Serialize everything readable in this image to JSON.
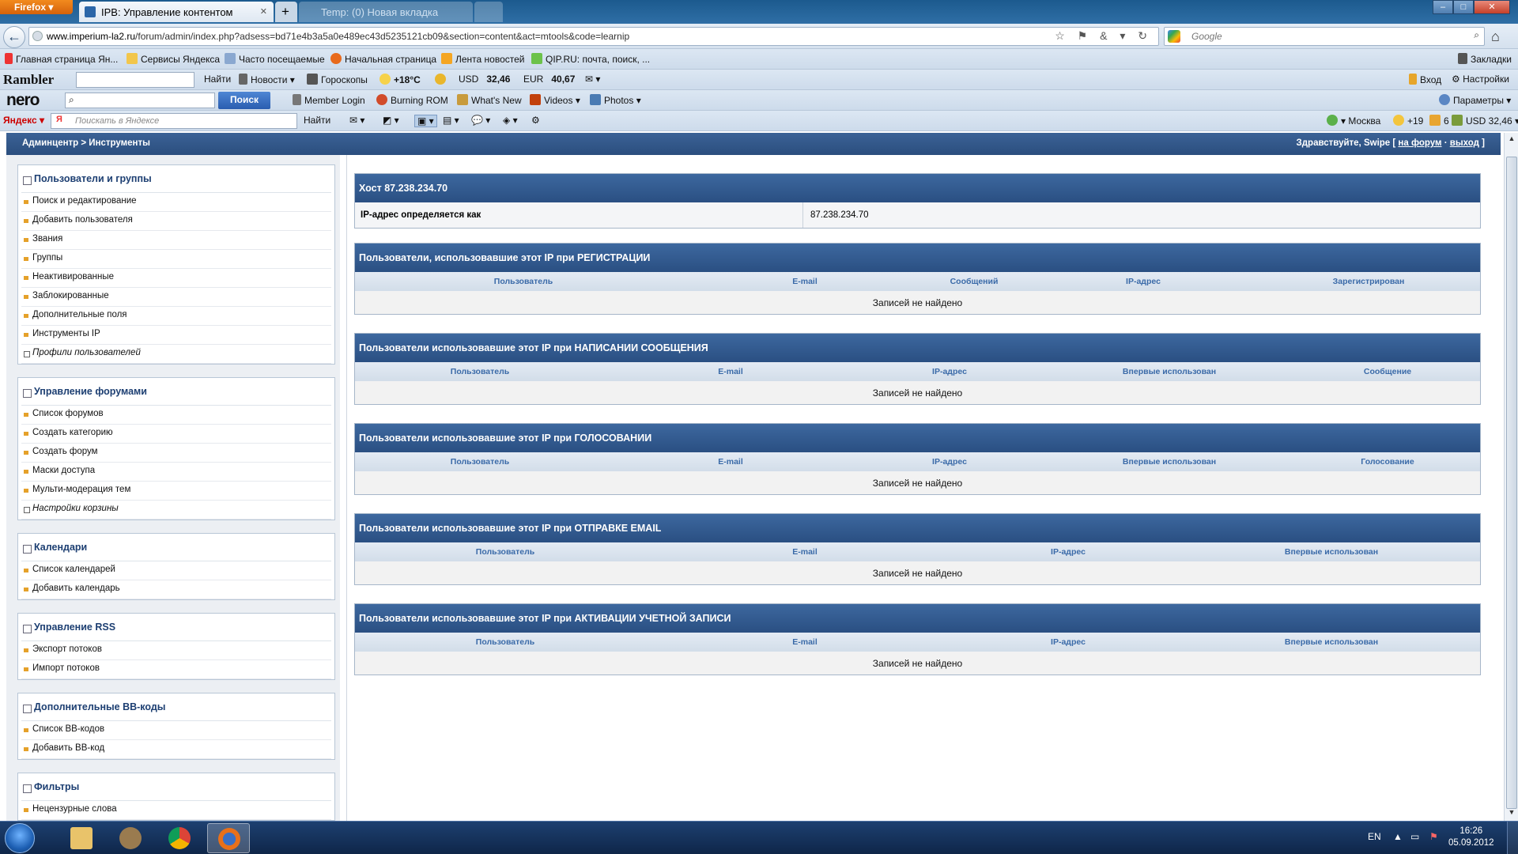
{
  "browser": {
    "firefox_label": "Firefox",
    "tabs": [
      {
        "title": "IPB: Управление контентом"
      },
      {
        "title": "Temp: (0) Новая вкладка"
      }
    ],
    "new_tab": "+",
    "url_host": "www.imperium-la2.ru",
    "url_path": "/forum/admin/index.php?adsess=bd71e4b3a5a0e489ec43d5235121cb09&section=content&act=mtools&code=learnip",
    "search_placeholder": "Google",
    "controls": {
      "minimize": "–",
      "maximize": "□",
      "close": "✕"
    }
  },
  "bookmarks": {
    "items": [
      "Главная страница Ян...",
      "Сервисы Яндекса",
      "Часто посещаемые",
      "Начальная страница",
      "Лента новостей",
      "QIP.RU: почта, поиск, ..."
    ],
    "right": "Закладки"
  },
  "rambler_bar": {
    "logo": "Rambler",
    "find": "Найти",
    "news": "Новости",
    "horoscopes": "Гороскопы",
    "temp": "+18°C",
    "usd_label": "USD",
    "usd": "32,46",
    "eur_label": "EUR",
    "eur": "40,67",
    "login": "Вход",
    "settings": "Настройки"
  },
  "nero_bar": {
    "logo": "nero",
    "search_btn": "Поиск",
    "items": [
      "Member Login",
      "Burning ROM",
      "What's New",
      "Videos",
      "Photos"
    ],
    "params": "Параметры"
  },
  "yandex_bar": {
    "logo": "Яндекс",
    "placeholder": "Поискать в Яндексе",
    "find": "Найти",
    "city": "Москва",
    "temp": "+19",
    "count": "6",
    "usd": "USD 32,46"
  },
  "page": {
    "breadcrumb": "Админцентр > Инструменты",
    "greeting_prefix": "Здравствуйте, Swipe [",
    "to_forum": "на форум",
    "sep": " · ",
    "logout": "выход",
    "greeting_suffix": "]"
  },
  "menu": [
    {
      "title": "Пользователи и группы",
      "items": [
        "Поиск и редактирование",
        "Добавить пользователя",
        "Звания",
        "Группы",
        "Неактивированные",
        "Заблокированные",
        "Дополнительные поля",
        "Инструменты IP"
      ],
      "italic": "Профили пользователей"
    },
    {
      "title": "Управление форумами",
      "items": [
        "Список форумов",
        "Создать категорию",
        "Создать форум",
        "Маски доступа",
        "Мульти-модерация тем"
      ],
      "italic": "Настройки корзины"
    },
    {
      "title": "Календари",
      "items": [
        "Список календарей",
        "Добавить календарь"
      ]
    },
    {
      "title": "Управление RSS",
      "items": [
        "Экспорт потоков",
        "Импорт потоков"
      ]
    },
    {
      "title": "Дополнительные BB-коды",
      "items": [
        "Список BB-кодов",
        "Добавить BB-код"
      ]
    },
    {
      "title": "Фильтры",
      "items": [
        "Нецензурные слова"
      ]
    }
  ],
  "host": {
    "title": "Хост 87.238.234.70",
    "label": "IP-адрес определяется как",
    "value": "87.238.234.70"
  },
  "tables": [
    {
      "title": "Пользователи, использовавшие этот IP при РЕГИСТРАЦИИ",
      "columns": [
        "Пользователь",
        "E-mail",
        "Сообщений",
        "IP-адрес",
        "Зарегистрирован"
      ],
      "empty": "Записей не найдено"
    },
    {
      "title": "Пользователи использовавшие этот IP при НАПИСАНИИ СООБЩЕНИЯ",
      "columns": [
        "Пользователь",
        "E-mail",
        "IP-адрес",
        "Впервые использован",
        "Сообщение"
      ],
      "empty": "Записей не найдено"
    },
    {
      "title": "Пользователи использовавшие этот IP при ГОЛОСОВАНИИ",
      "columns": [
        "Пользователь",
        "E-mail",
        "IP-адрес",
        "Впервые использован",
        "Голосование"
      ],
      "empty": "Записей не найдено"
    },
    {
      "title": "Пользователи использовавшие этот IP при ОТПРАВКЕ EMAIL",
      "columns": [
        "Пользователь",
        "E-mail",
        "IP-адрес",
        "Впервые использован"
      ],
      "empty": "Записей не найдено"
    },
    {
      "title": "Пользователи использовавшие этот IP при АКТИВАЦИИ УЧЕТНОЙ ЗАПИСИ",
      "columns": [
        "Пользователь",
        "E-mail",
        "IP-адрес",
        "Впервые использован"
      ],
      "empty": "Записей не найдено"
    }
  ],
  "taskbar": {
    "lang": "EN",
    "time": "16:26",
    "date": "05.09.2012"
  },
  "colors": {
    "header_blue": "#2b4e7e",
    "column_link": "#3a6aa8",
    "bullet": "#e5a12a",
    "menu_title": "#1d3f72"
  }
}
